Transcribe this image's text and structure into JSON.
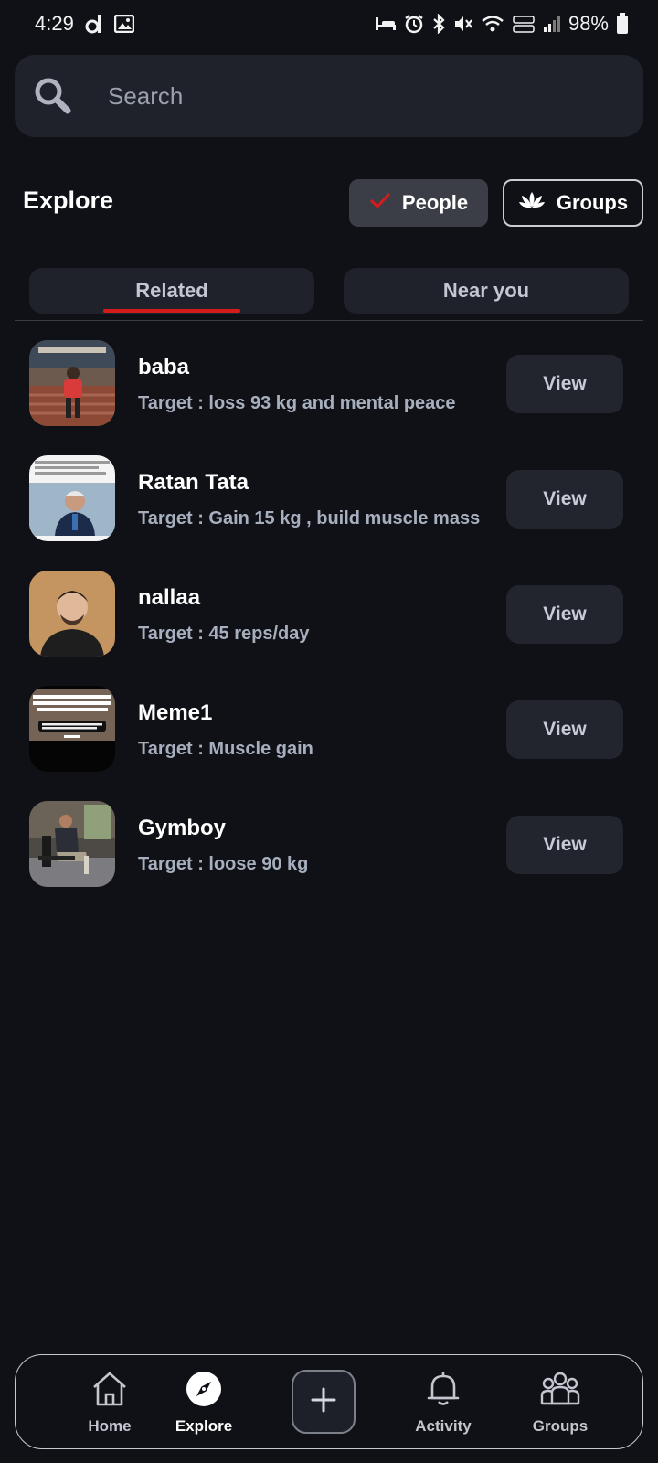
{
  "status_bar": {
    "time": "4:29",
    "battery": "98%",
    "left_icons": [
      "d-app-icon",
      "gallery-icon"
    ],
    "right_icons": [
      "sleep-icon",
      "alarm-icon",
      "bluetooth-icon",
      "mute-icon",
      "wifi-icon",
      "volte-icon",
      "signal-icon",
      "battery-icon"
    ]
  },
  "search": {
    "placeholder": "Search",
    "icon": "search-icon"
  },
  "header": {
    "title": "Explore",
    "filters": {
      "people": "People",
      "groups": "Groups"
    }
  },
  "tabs": {
    "related": "Related",
    "near_you": "Near you"
  },
  "people": [
    {
      "name": "baba",
      "target": "Target : loss 93 kg and mental peace",
      "button": "View"
    },
    {
      "name": "Ratan Tata",
      "target": "Target : Gain 15 kg , build muscle mass",
      "button": "View"
    },
    {
      "name": "nallaa",
      "target": "Target : 45 reps/day",
      "button": "View"
    },
    {
      "name": "Meme1",
      "target": "Target : Muscle gain",
      "button": "View"
    },
    {
      "name": "Gymboy",
      "target": "Target : loose 90 kg",
      "button": "View"
    }
  ],
  "bottom_nav": {
    "home": "Home",
    "explore": "Explore",
    "activity": "Activity",
    "groups": "Groups",
    "active": "Explore"
  },
  "colors": {
    "background": "#0f1116",
    "surface": "#1f222b",
    "accent_red": "#d51c1c",
    "muted_text": "#a7aebd"
  }
}
